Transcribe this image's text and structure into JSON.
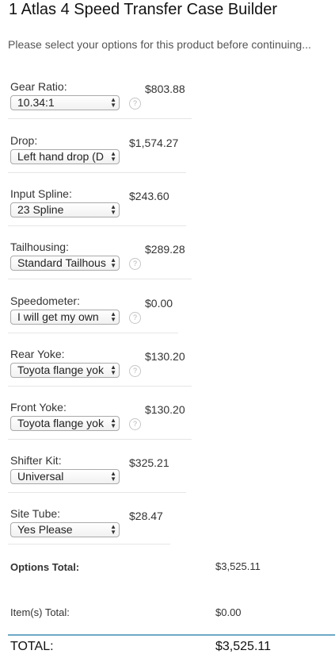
{
  "product": {
    "title": "1 Atlas 4 Speed Transfer Case Builder",
    "subtitle": "Please select your options for this product before continuing..."
  },
  "options": [
    {
      "label": "Gear Ratio:",
      "value": "10.34:1",
      "price": "$803.88",
      "help": true
    },
    {
      "label": "Drop:",
      "value": "Left hand drop (D",
      "price": "$1,574.27",
      "help": false
    },
    {
      "label": "Input Spline:",
      "value": "23 Spline",
      "price": "$243.60",
      "help": false
    },
    {
      "label": "Tailhousing:",
      "value": "Standard Tailhous",
      "price": "$289.28",
      "help": true
    },
    {
      "label": "Speedometer:",
      "value": "I will get my own",
      "price": "$0.00",
      "help": true
    },
    {
      "label": "Rear Yoke:",
      "value": "Toyota flange yok",
      "price": "$130.20",
      "help": true
    },
    {
      "label": "Front Yoke:",
      "value": "Toyota flange yok",
      "price": "$130.20",
      "help": true
    },
    {
      "label": "Shifter Kit:",
      "value": "Universal",
      "price": "$325.21",
      "help": false
    },
    {
      "label": "Site Tube:",
      "value": "Yes Please",
      "price": "$28.47",
      "help": false
    }
  ],
  "totals": {
    "options_label": "Options Total:",
    "options_value": "$3,525.11",
    "items_label": "Item(s) Total:",
    "items_value": "$0.00",
    "total_label": "TOTAL:",
    "total_value": "$3,525.11"
  },
  "icons": {
    "help": "question-circle-icon",
    "select_arrows": "updown-arrows-icon"
  },
  "colors": {
    "total_rule": "#6fa8c7",
    "help_icon": "#b5b5b5"
  }
}
